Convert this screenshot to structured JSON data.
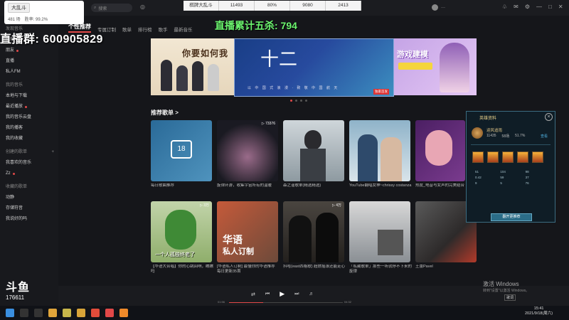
{
  "overlay": {
    "search_chip": "大乱斗",
    "stats_a": "481 场",
    "stats_b": "胜率: 99.2%",
    "qq_group": "直播群: 600905829",
    "kills": "直播累计五杀: 794",
    "top_stats": [
      "棋牌大乱斗",
      "11493",
      "80%",
      "9080",
      "2413"
    ]
  },
  "app": {
    "nav_tabs": [
      "个性推荐",
      "专属订制",
      "歌单",
      "排行榜",
      "歌手",
      "最新音乐"
    ],
    "sidebar_items": [
      {
        "label": "发现音乐",
        "head": true
      },
      {
        "label": "视频"
      },
      {
        "label": "朋友",
        "dot": true
      },
      {
        "label": "直播"
      },
      {
        "label": "私人FM"
      },
      {
        "label": "我的音乐",
        "head": true
      },
      {
        "label": "本地与下载"
      },
      {
        "label": "最近播放",
        "dot": true
      },
      {
        "label": "我的音乐云盘"
      },
      {
        "label": "我的播客"
      },
      {
        "label": "我的收藏"
      },
      {
        "label": "创建的歌单",
        "head": true,
        "plus": true
      },
      {
        "label": "我喜欢的音乐"
      },
      {
        "label": "Zz",
        "dot": true
      },
      {
        "label": "收藏的歌单",
        "head": true
      },
      {
        "label": "动静"
      },
      {
        "label": "存储符音"
      },
      {
        "label": "我说好的吗"
      }
    ],
    "section_title": "推荐歌单 >",
    "banner_left_title": "你要如何我",
    "banner_center_sub": "以 中 国 式 浪 漫 · 致 敬 中 国 航 天",
    "banner_center_tag": "独家首发",
    "banner_right_title": "游戏建模",
    "playlists_row1": [
      {
        "title": "每日歌曲推荐",
        "count": ""
      },
      {
        "title": "旋律环游，收集宇宙所有的温暖",
        "count": "▷ 73376"
      },
      {
        "title": "森之谣歌单(精选精选)",
        "count": ""
      },
      {
        "title": "YouTube翻唱女神~chrissy costanza",
        "count": ""
      },
      {
        "title": "热度_电音与女声的完美结合",
        "count": ""
      }
    ],
    "playlists_row2": [
      {
        "title": "【华语大合唱】你的心跳回响，瞧瞧吗",
        "count": "▷ 3万"
      },
      {
        "title": "[华语私人订制] 最懂你的华语推荐 每日更新35首",
        "count": ""
      },
      {
        "title": "抖哈(east西格歌) 超燃摇滚还能走心",
        "count": "▷ 4万"
      },
      {
        "title": "「私藏歌单」那些一听就停不下来的旋律",
        "count": ""
      },
      {
        "title": "王蕾Pavel",
        "count": ""
      }
    ],
    "daily_day": "18",
    "row2_art_text": "一个人孤独终老了",
    "row2_hy_title": "华语",
    "row2_hy_sub": "私人订制"
  },
  "panel": {
    "title": "英雄资料",
    "name": "迎风追雨",
    "stat1": "11435",
    "stat2": "58场",
    "stat3": "51.7%",
    "link": "查看",
    "nums": [
      "51",
      "104",
      "98",
      "0.42",
      "59",
      "37",
      "9",
      "5",
      "76"
    ],
    "button": "翻开更推荐"
  },
  "player": {
    "time_left": "01:56",
    "time_right": "04:32",
    "lyric_btn": "歌词"
  },
  "watermark": {
    "line1": "激活 Windows",
    "line2": "转到\"设置\"以激活 Windows。"
  },
  "douyu": {
    "logo": "斗鱼",
    "room": "176611"
  },
  "taskbar": {
    "time": "15:41",
    "date": "2021/9/18(周六)"
  },
  "colors": {
    "accent": "#e14848",
    "kills_green": "#6cf56f",
    "panel_bg": "#0f1d26"
  }
}
